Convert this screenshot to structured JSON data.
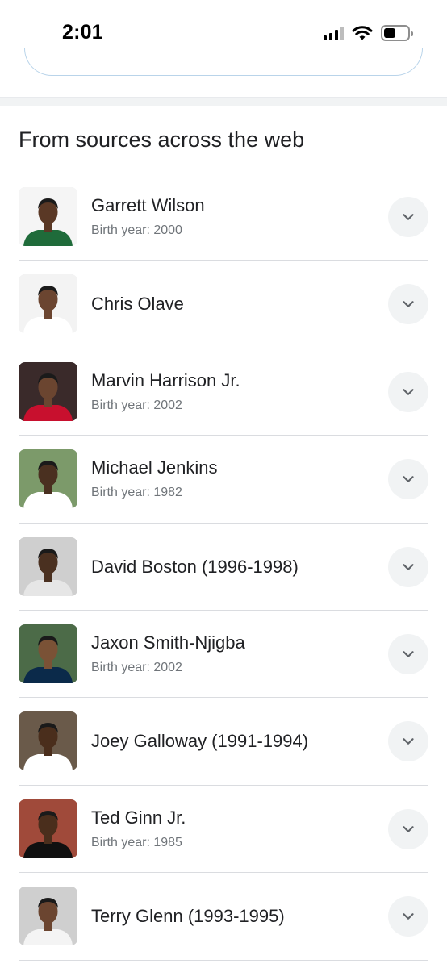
{
  "status_bar": {
    "time": "2:01"
  },
  "section": {
    "heading": "From sources across the web"
  },
  "results": [
    {
      "name": "Garrett Wilson",
      "subtitle": "Birth year: 2000",
      "thumb": {
        "bg": "#f5f5f5",
        "skin": "#5a3825",
        "jersey": "#1f6b3a"
      }
    },
    {
      "name": "Chris Olave",
      "subtitle": "",
      "thumb": {
        "bg": "#f3f3f3",
        "skin": "#6b4530",
        "jersey": "#ffffff"
      }
    },
    {
      "name": "Marvin Harrison Jr.",
      "subtitle": "Birth year: 2002",
      "thumb": {
        "bg": "#3a2a2a",
        "skin": "#6b4530",
        "jersey": "#c8102e"
      }
    },
    {
      "name": "Michael Jenkins",
      "subtitle": "Birth year: 1982",
      "thumb": {
        "bg": "#7c9a6a",
        "skin": "#4a3020",
        "jersey": "#ffffff"
      }
    },
    {
      "name": "David Boston (1996-1998)",
      "subtitle": "",
      "thumb": {
        "bg": "#cfcfcf",
        "skin": "#4a3020",
        "jersey": "#e6e6e6"
      }
    },
    {
      "name": "Jaxon Smith-Njigba",
      "subtitle": "Birth year: 2002",
      "thumb": {
        "bg": "#4c6b48",
        "skin": "#7a5236",
        "jersey": "#0b2a4a"
      }
    },
    {
      "name": "Joey Galloway (1991-1994)",
      "subtitle": "",
      "thumb": {
        "bg": "#6a5a4a",
        "skin": "#4a2e1c",
        "jersey": "#ffffff"
      }
    },
    {
      "name": "Ted Ginn Jr.",
      "subtitle": "Birth year: 1985",
      "thumb": {
        "bg": "#a04a3a",
        "skin": "#4a2e1c",
        "jersey": "#101010"
      }
    },
    {
      "name": "Terry Glenn (1993-1995)",
      "subtitle": "",
      "thumb": {
        "bg": "#cfcfcf",
        "skin": "#6b4530",
        "jersey": "#f4f4f4"
      }
    }
  ]
}
